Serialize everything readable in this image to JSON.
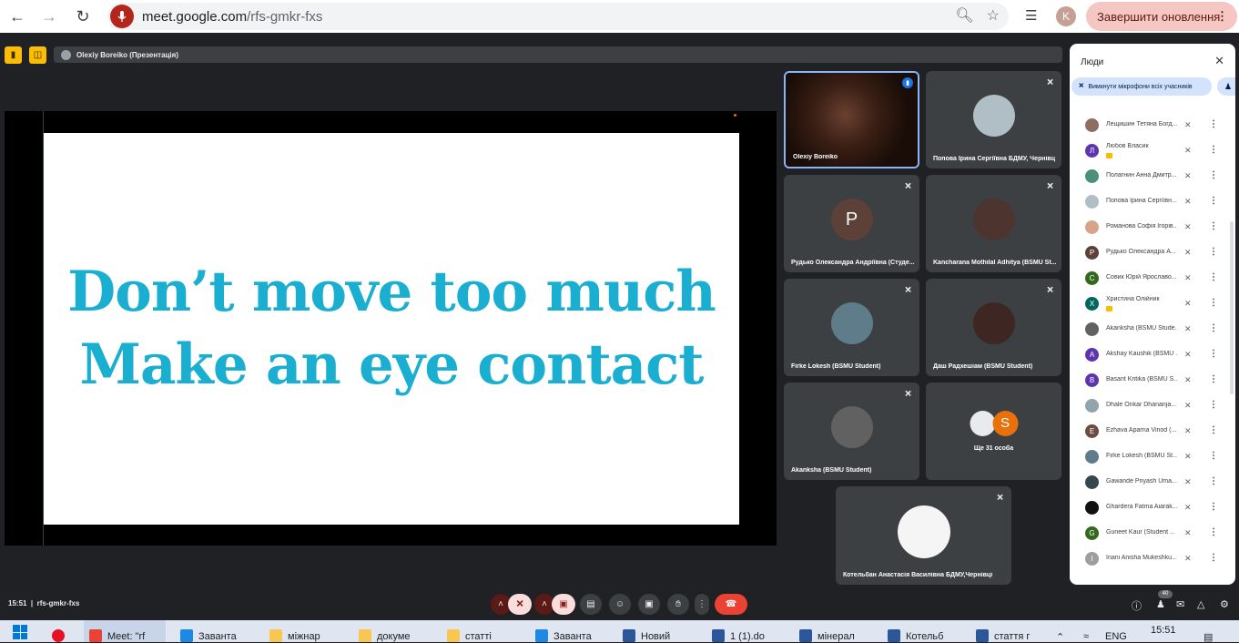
{
  "browser": {
    "url_host": "meet.google.com",
    "url_path": "/rfs-gmkr-fxs",
    "profile_initial": "K",
    "update_label": "Завершити оновлення"
  },
  "meet": {
    "presenting_label": "Olexiy Boreiko (Презентація)",
    "slide_line1": "Don’t move too much",
    "slide_line2": "Make an eye contact",
    "tiles": [
      {
        "name": "Olexiy Boreiko",
        "initial": "",
        "color": "#000000"
      },
      {
        "name": "Попова Ірина Сергіївна БДМУ, Чернівц",
        "initial": "",
        "color": "#b0bec5"
      },
      {
        "name": "Рудько Олександра Андріївна (Студе...",
        "initial": "P",
        "color": "#5d4037"
      },
      {
        "name": "Kancharana Mothilal Adhitya (BSMU St...",
        "initial": "",
        "color": "#4e342e"
      },
      {
        "name": "Firke Lokesh (BSMU Student)",
        "initial": "",
        "color": "#5f7c8a"
      },
      {
        "name": "Даш Радхешіам (BSMU Student)",
        "initial": "",
        "color": "#3e2723"
      },
      {
        "name": "Akanksha (BSMU Student)",
        "initial": "",
        "color": "#616161"
      },
      {
        "name": "Котельбан Анастасія Василівна БДМУ,Чернівці",
        "initial": "",
        "color": "#f5f5f5"
      }
    ],
    "more_people": {
      "label": "Ще 31 особа",
      "initial": "S"
    },
    "time": "15:51",
    "meeting_code": "rfs-gmkr-fxs",
    "participant_count": "40"
  },
  "people_panel": {
    "title": "Люди",
    "mute_all_label": "Вимкнути мікрофони всіх учасників",
    "participants": [
      {
        "name": "Лещишин Тетяна Богд...",
        "initial": "",
        "color": "#8d6e63",
        "badge": false
      },
      {
        "name": "Любов Власик",
        "initial": "Л",
        "color": "#5e35b1",
        "badge": true
      },
      {
        "name": "Полагнин Анна Дмитр...",
        "initial": "",
        "color": "#4a8f7b",
        "badge": false
      },
      {
        "name": "Попова Ірина Сергіївн...",
        "initial": "",
        "color": "#b0bec5",
        "badge": false
      },
      {
        "name": "Романова Софія Ігорів...",
        "initial": "",
        "color": "#d7a48a",
        "badge": false
      },
      {
        "name": "Рудько Олександра А...",
        "initial": "P",
        "color": "#5d4037",
        "badge": false
      },
      {
        "name": "Совик Юрій Ярославо...",
        "initial": "C",
        "color": "#33691e",
        "badge": false
      },
      {
        "name": "Христина Олійник",
        "initial": "X",
        "color": "#00695c",
        "badge": true
      },
      {
        "name": "Akanksha (BSMU Stude...",
        "initial": "",
        "color": "#616161",
        "badge": false
      },
      {
        "name": "Akshay Kaushik (BSMU ...",
        "initial": "A",
        "color": "#5e35b1",
        "badge": false
      },
      {
        "name": "Basant Kritika (BSMU S...",
        "initial": "B",
        "color": "#5e35b1",
        "badge": false
      },
      {
        "name": "Dhale Onkar Dhananja...",
        "initial": "",
        "color": "#90a4ae",
        "badge": false
      },
      {
        "name": "Ezhava Aparna Vinod (...",
        "initial": "E",
        "color": "#6d4c41",
        "badge": false
      },
      {
        "name": "Firke Lokesh (BSMU St...",
        "initial": "",
        "color": "#5f7c8a",
        "badge": false
      },
      {
        "name": "Gawande Priyash Uma...",
        "initial": "",
        "color": "#37474f",
        "badge": false
      },
      {
        "name": "Ghardera Fatma Aiarak...",
        "initial": "",
        "color": "#111111",
        "badge": false
      },
      {
        "name": "Guneet Kaur (Student ...",
        "initial": "G",
        "color": "#33691e",
        "badge": false
      },
      {
        "name": "Inani Anisha Mukeshku...",
        "initial": "I",
        "color": "#9e9e9e",
        "badge": false
      }
    ]
  },
  "taskbar": {
    "items": [
      {
        "label": "Meet: \"rf",
        "color": "#ea4335"
      },
      {
        "label": "Заванта",
        "color": "#1e88e5"
      },
      {
        "label": "міжнар",
        "color": "#f9c74f"
      },
      {
        "label": "докуме",
        "color": "#f9c74f"
      },
      {
        "label": "статті",
        "color": "#f9c74f"
      },
      {
        "label": "Заванта",
        "color": "#1e88e5"
      },
      {
        "label": "Новий",
        "color": "#2b579a"
      },
      {
        "label": "1 (1).do",
        "color": "#2b579a"
      },
      {
        "label": "мінерал",
        "color": "#2b579a"
      },
      {
        "label": "Котельб",
        "color": "#2b579a"
      },
      {
        "label": "стаття г",
        "color": "#2b579a"
      }
    ],
    "language": "ENG",
    "clock": "15:51"
  }
}
